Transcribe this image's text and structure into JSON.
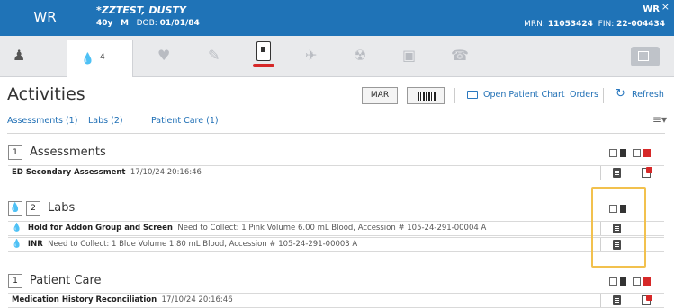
{
  "header": {
    "code": "WR",
    "patient_name": "*ZZTEST, DUSTY",
    "age": "40y",
    "sex": "M",
    "dob_label": "DOB:",
    "dob": "01/01/84",
    "right_code": "WR",
    "close_glyph": "×",
    "mrn_label": "MRN:",
    "mrn": "11053424",
    "fin_label": "FIN:",
    "fin": "22-004434"
  },
  "iconbar": {
    "active_count": "4",
    "icons": [
      "person-icon",
      "drop-icon",
      "heart-icon",
      "pill-icon",
      "scanner-icon",
      "plane-icon",
      "radiation-icon",
      "bag-icon",
      "phone-icon"
    ]
  },
  "page": {
    "title": "Activities",
    "mar_label": "MAR",
    "open_chart_label": "Open Patient Chart",
    "orders_label": "Orders",
    "refresh_label": "Refresh"
  },
  "tabs": [
    {
      "label": "Assessments (1)"
    },
    {
      "label": "Labs (2)"
    },
    {
      "label": "Patient Care (1)"
    }
  ],
  "sections": [
    {
      "count": "1",
      "title": "Assessments",
      "rows": [
        {
          "name": "ED Secondary Assessment",
          "detail": "17/10/24 20:16:46"
        }
      ]
    },
    {
      "count": "2",
      "title": "Labs",
      "rows": [
        {
          "name": "Hold for Addon Group and Screen",
          "detail": "Need to Collect: 1 Pink Volume 6.00 mL Blood, Accession # 105-24-291-00004 A"
        },
        {
          "name": "INR",
          "detail": "Need to Collect: 1 Blue Volume 1.80 mL Blood, Accession # 105-24-291-00003 A"
        }
      ]
    },
    {
      "count": "1",
      "title": "Patient Care",
      "rows": [
        {
          "name": "Medication History Reconciliation",
          "detail": "17/10/24 20:16:46"
        }
      ]
    }
  ],
  "colors": {
    "header_blue": "#1f73b7",
    "link_blue": "#1f6fb5",
    "highlight": "#f2c14e",
    "alert_red": "#d62828"
  }
}
